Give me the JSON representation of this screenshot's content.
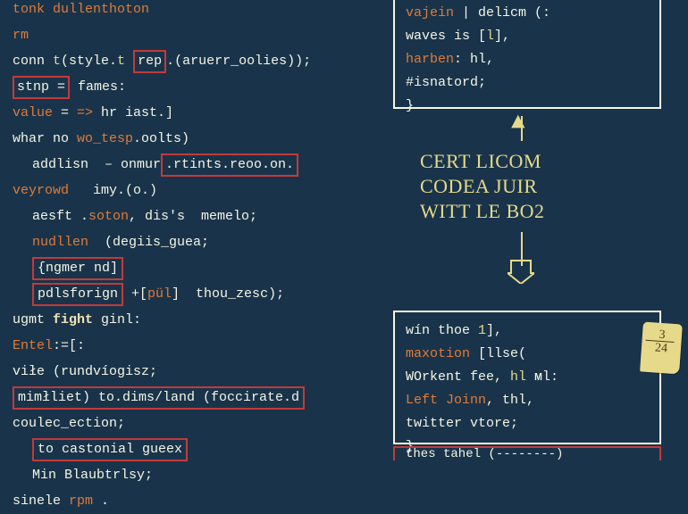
{
  "code": {
    "lines": [
      {
        "p": 0,
        "segs": [
          [
            "kw",
            "tonk"
          ],
          [
            "txt",
            " "
          ],
          [
            "kw",
            "dullenthoton"
          ]
        ]
      },
      {
        "p": 0,
        "segs": [
          [
            "kw",
            "rm"
          ]
        ]
      },
      {
        "p": 0,
        "segs": [
          [
            "txt",
            "conn "
          ],
          [
            "str",
            "t"
          ],
          [
            "txt",
            "(style."
          ],
          [
            "str",
            "t"
          ],
          [
            "txt",
            " "
          ],
          [
            "hl",
            "rep"
          ],
          [
            "txt",
            ".(aruerr_oolies));"
          ]
        ]
      },
      {
        "p": 0,
        "segs": [
          [
            "hl",
            "stnp ="
          ],
          [
            "txt",
            " fames:"
          ]
        ]
      },
      {
        "p": 0,
        "segs": [
          [
            "kw",
            "value"
          ],
          [
            "txt",
            " = "
          ],
          [
            "op",
            "=>"
          ],
          [
            "txt",
            " hr iast.]"
          ]
        ]
      },
      {
        "p": 0,
        "segs": [
          [
            "txt",
            "whar no "
          ],
          [
            "kw",
            "wo_tesp"
          ],
          [
            "txt",
            ".oolts)"
          ]
        ]
      },
      {
        "p": 1,
        "segs": [
          [
            "txt",
            "addlisn  – onmur"
          ],
          [
            "hl",
            ".rtints.reoo.on."
          ]
        ]
      },
      {
        "p": 0,
        "segs": [
          [
            "kw",
            "veyrowd"
          ],
          [
            "txt",
            "   imy.(o.)"
          ]
        ]
      },
      {
        "p": 1,
        "segs": [
          [
            "txt",
            "aesft ."
          ],
          [
            "kw",
            "soton"
          ],
          [
            "txt",
            ", dis's  memelo;"
          ]
        ]
      },
      {
        "p": 1,
        "segs": [
          [
            "kw",
            "nudllen"
          ],
          [
            "txt",
            "  (degiis_guea;"
          ]
        ]
      },
      {
        "p": 1,
        "segs": [
          [
            "hl2",
            "{ngmer nd]"
          ]
        ]
      },
      {
        "p": 1,
        "segs": [
          [
            "hl2",
            "pdlsforign"
          ],
          [
            "txt",
            " +["
          ],
          [
            "kw",
            "pül"
          ],
          [
            "txt",
            "]  thou_zesc);"
          ]
        ]
      },
      {
        "p": 0,
        "segs": [
          [
            "txt",
            "ugmt "
          ],
          [
            "fn",
            "fight"
          ],
          [
            "txt",
            " ginl:"
          ]
        ]
      },
      {
        "p": 0,
        "segs": [
          [
            "kw",
            "Entel"
          ],
          [
            "txt",
            ":=[:"
          ]
        ]
      },
      {
        "p": 0,
        "segs": [
          [
            "txt",
            "viłe (rundvíogisz;"
          ]
        ]
      },
      {
        "p": 0,
        "segs": [
          [
            "hl2",
            "mimłliet) to.dims/land (foccirate.d"
          ]
        ]
      },
      {
        "p": 0,
        "segs": [
          [
            "txt",
            "coulec_ection;"
          ]
        ]
      },
      {
        "p": 1,
        "segs": [
          [
            "hl2",
            "to castonial gueex"
          ]
        ]
      },
      {
        "p": 1,
        "segs": [
          [
            "txt",
            "Min Blaubtrlsy;"
          ]
        ]
      },
      {
        "p": 0,
        "segs": [
          [
            "txt",
            "sinele "
          ],
          [
            "kw",
            "rpm"
          ],
          [
            "txt",
            " ."
          ]
        ]
      }
    ]
  },
  "boxes": {
    "top": {
      "lines": [
        [
          [
            "kw",
            "vajein"
          ],
          [
            "txt",
            " | delicm (:"
          ]
        ],
        [
          [
            "txt",
            "waves is ["
          ],
          [
            "str",
            "l"
          ],
          [
            "txt",
            "],"
          ]
        ],
        [
          [
            "kw",
            "harben"
          ],
          [
            "txt",
            ":   hl,"
          ]
        ],
        [
          [
            "txt",
            "#isnatord;"
          ]
        ],
        [
          [
            "txt",
            "}"
          ]
        ]
      ]
    },
    "bottom": {
      "lines": [
        [
          [
            "txt",
            "wín thoe "
          ],
          [
            "str",
            "1"
          ],
          [
            "txt",
            "],"
          ]
        ],
        [
          [
            "kw",
            "maxotion"
          ],
          [
            "txt",
            " [llse("
          ]
        ],
        [
          [
            "txt",
            "  WOrkent fee, "
          ],
          [
            "str",
            "hl"
          ],
          [
            "txt",
            " ᴍl:"
          ]
        ],
        [
          [
            "txt",
            "  "
          ],
          [
            "kw",
            "Left Joinn"
          ],
          [
            "txt",
            ",  thl,"
          ]
        ],
        [
          [
            "txt",
            "  twitter vtore;"
          ]
        ],
        [
          [
            "txt",
            "}"
          ]
        ]
      ]
    }
  },
  "midLabel": {
    "l1": "CERT LICOM",
    "l2": "CODEA JUIR",
    "l3": "WITT LE BO2"
  },
  "sticky": {
    "t1": "3",
    "t2": "24"
  },
  "bottomRed": "thes tahel  (--------)"
}
